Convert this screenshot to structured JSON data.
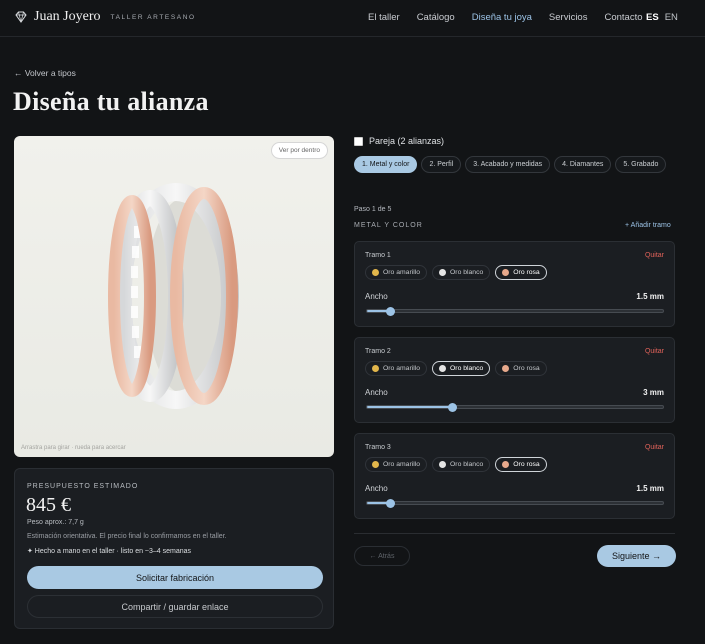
{
  "header": {
    "brand_name": "Juan Joyero",
    "brand_sub": "TALLER ARTESANO",
    "nav": [
      {
        "label": "El taller",
        "active": false
      },
      {
        "label": "Catálogo",
        "active": false
      },
      {
        "label": "Diseña tu joya",
        "active": true
      },
      {
        "label": "Servicios",
        "active": false
      },
      {
        "label": "Contacto",
        "active": false
      }
    ],
    "lang_current": "ES",
    "lang_alt": "EN"
  },
  "back_link": "← Volver a tipos",
  "page_title": "Diseña tu alianza",
  "preview": {
    "view_inside": "Ver por dentro",
    "hint": "Arrastra para girar · rueda para acercar"
  },
  "budget": {
    "label": "PRESUPUESTO ESTIMADO",
    "price": "845 €",
    "weight": "Peso aprox.: 7,7 g",
    "estimate_note": "Estimación orientativa. El precio final lo confirmamos en el taller.",
    "handmade": "✦  Hecho a mano en el taller · listo en ~3–4 semanas",
    "request_button": "Solicitar fabricación",
    "share_button": "Compartir / guardar enlace"
  },
  "pair_label": "Pareja (2 alianzas)",
  "steps": [
    {
      "label": "1. Metal y color",
      "active": true
    },
    {
      "label": "2. Perfil",
      "active": false
    },
    {
      "label": "3. Acabado y medidas",
      "active": false
    },
    {
      "label": "4. Diamantes",
      "active": false
    },
    {
      "label": "5. Grabado",
      "active": false
    }
  ],
  "step_count": "Paso 1 de 5",
  "section_title": "METAL Y COLOR",
  "add_section": "+ Añadir tramo",
  "metal_colors": {
    "Oro amarillo": "#e2b64b",
    "Oro blanco": "#e4e4e4",
    "Oro rosa": "#e7a98c"
  },
  "tramos": [
    {
      "title": "Tramo 1",
      "remove": "Quitar",
      "metals": [
        "Oro amarillo",
        "Oro blanco",
        "Oro rosa"
      ],
      "selected": "Oro rosa",
      "width_label": "Ancho",
      "width_value": "1.5 mm",
      "slider_fraction": 0.08
    },
    {
      "title": "Tramo 2",
      "remove": "Quitar",
      "metals": [
        "Oro amarillo",
        "Oro blanco",
        "Oro rosa"
      ],
      "selected": "Oro blanco",
      "width_label": "Ancho",
      "width_value": "3 mm",
      "slider_fraction": 0.29
    },
    {
      "title": "Tramo 3",
      "remove": "Quitar",
      "metals": [
        "Oro amarillo",
        "Oro blanco",
        "Oro rosa"
      ],
      "selected": "Oro rosa",
      "width_label": "Ancho",
      "width_value": "1.5 mm",
      "slider_fraction": 0.08
    }
  ],
  "nav_buttons": {
    "back": "← Atrás",
    "next": "Siguiente →"
  }
}
